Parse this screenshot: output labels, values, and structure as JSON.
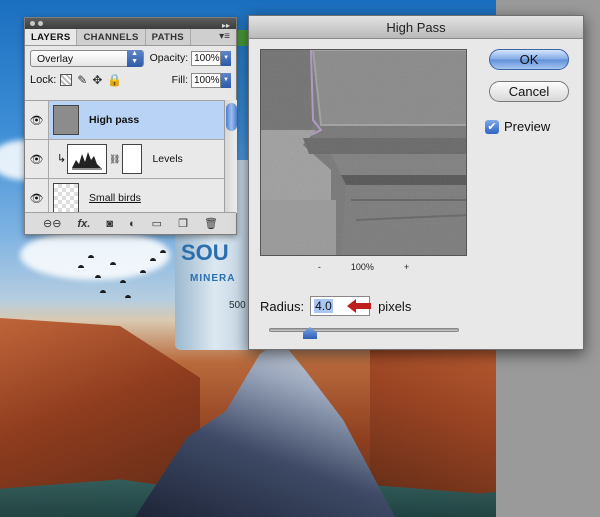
{
  "layers_panel": {
    "tabs": [
      "LAYERS",
      "CHANNELS",
      "PATHS"
    ],
    "blend_mode": "Overlay",
    "opacity_label": "Opacity:",
    "opacity_value": "100%",
    "lock_label": "Lock:",
    "fill_label": "Fill:",
    "fill_value": "100%",
    "layers": [
      {
        "name": "High pass",
        "selected": true
      },
      {
        "name": "Levels",
        "selected": false
      },
      {
        "name": "Small birds",
        "selected": false
      }
    ],
    "footer_icons": [
      "link-icon",
      "fx-icon",
      "mask-icon",
      "adjustment-icon",
      "group-icon",
      "new-layer-icon",
      "trash-icon"
    ],
    "footer_fx": "fx."
  },
  "dialog": {
    "title": "High Pass",
    "ok_label": "OK",
    "cancel_label": "Cancel",
    "preview_label": "Preview",
    "preview_checked": true,
    "zoom_out": "-",
    "zoom_level": "100%",
    "zoom_in": "+",
    "radius_label": "Radius:",
    "radius_value": "4.0",
    "radius_unit": "pixels"
  },
  "canvas": {
    "bottle_brand": "SOU",
    "bottle_sub": "MINERA",
    "bottle_volume": "500"
  },
  "colors": {
    "selection": "#b8d3f5",
    "accent": "#3b64a4",
    "arrow": "#c0201c"
  }
}
